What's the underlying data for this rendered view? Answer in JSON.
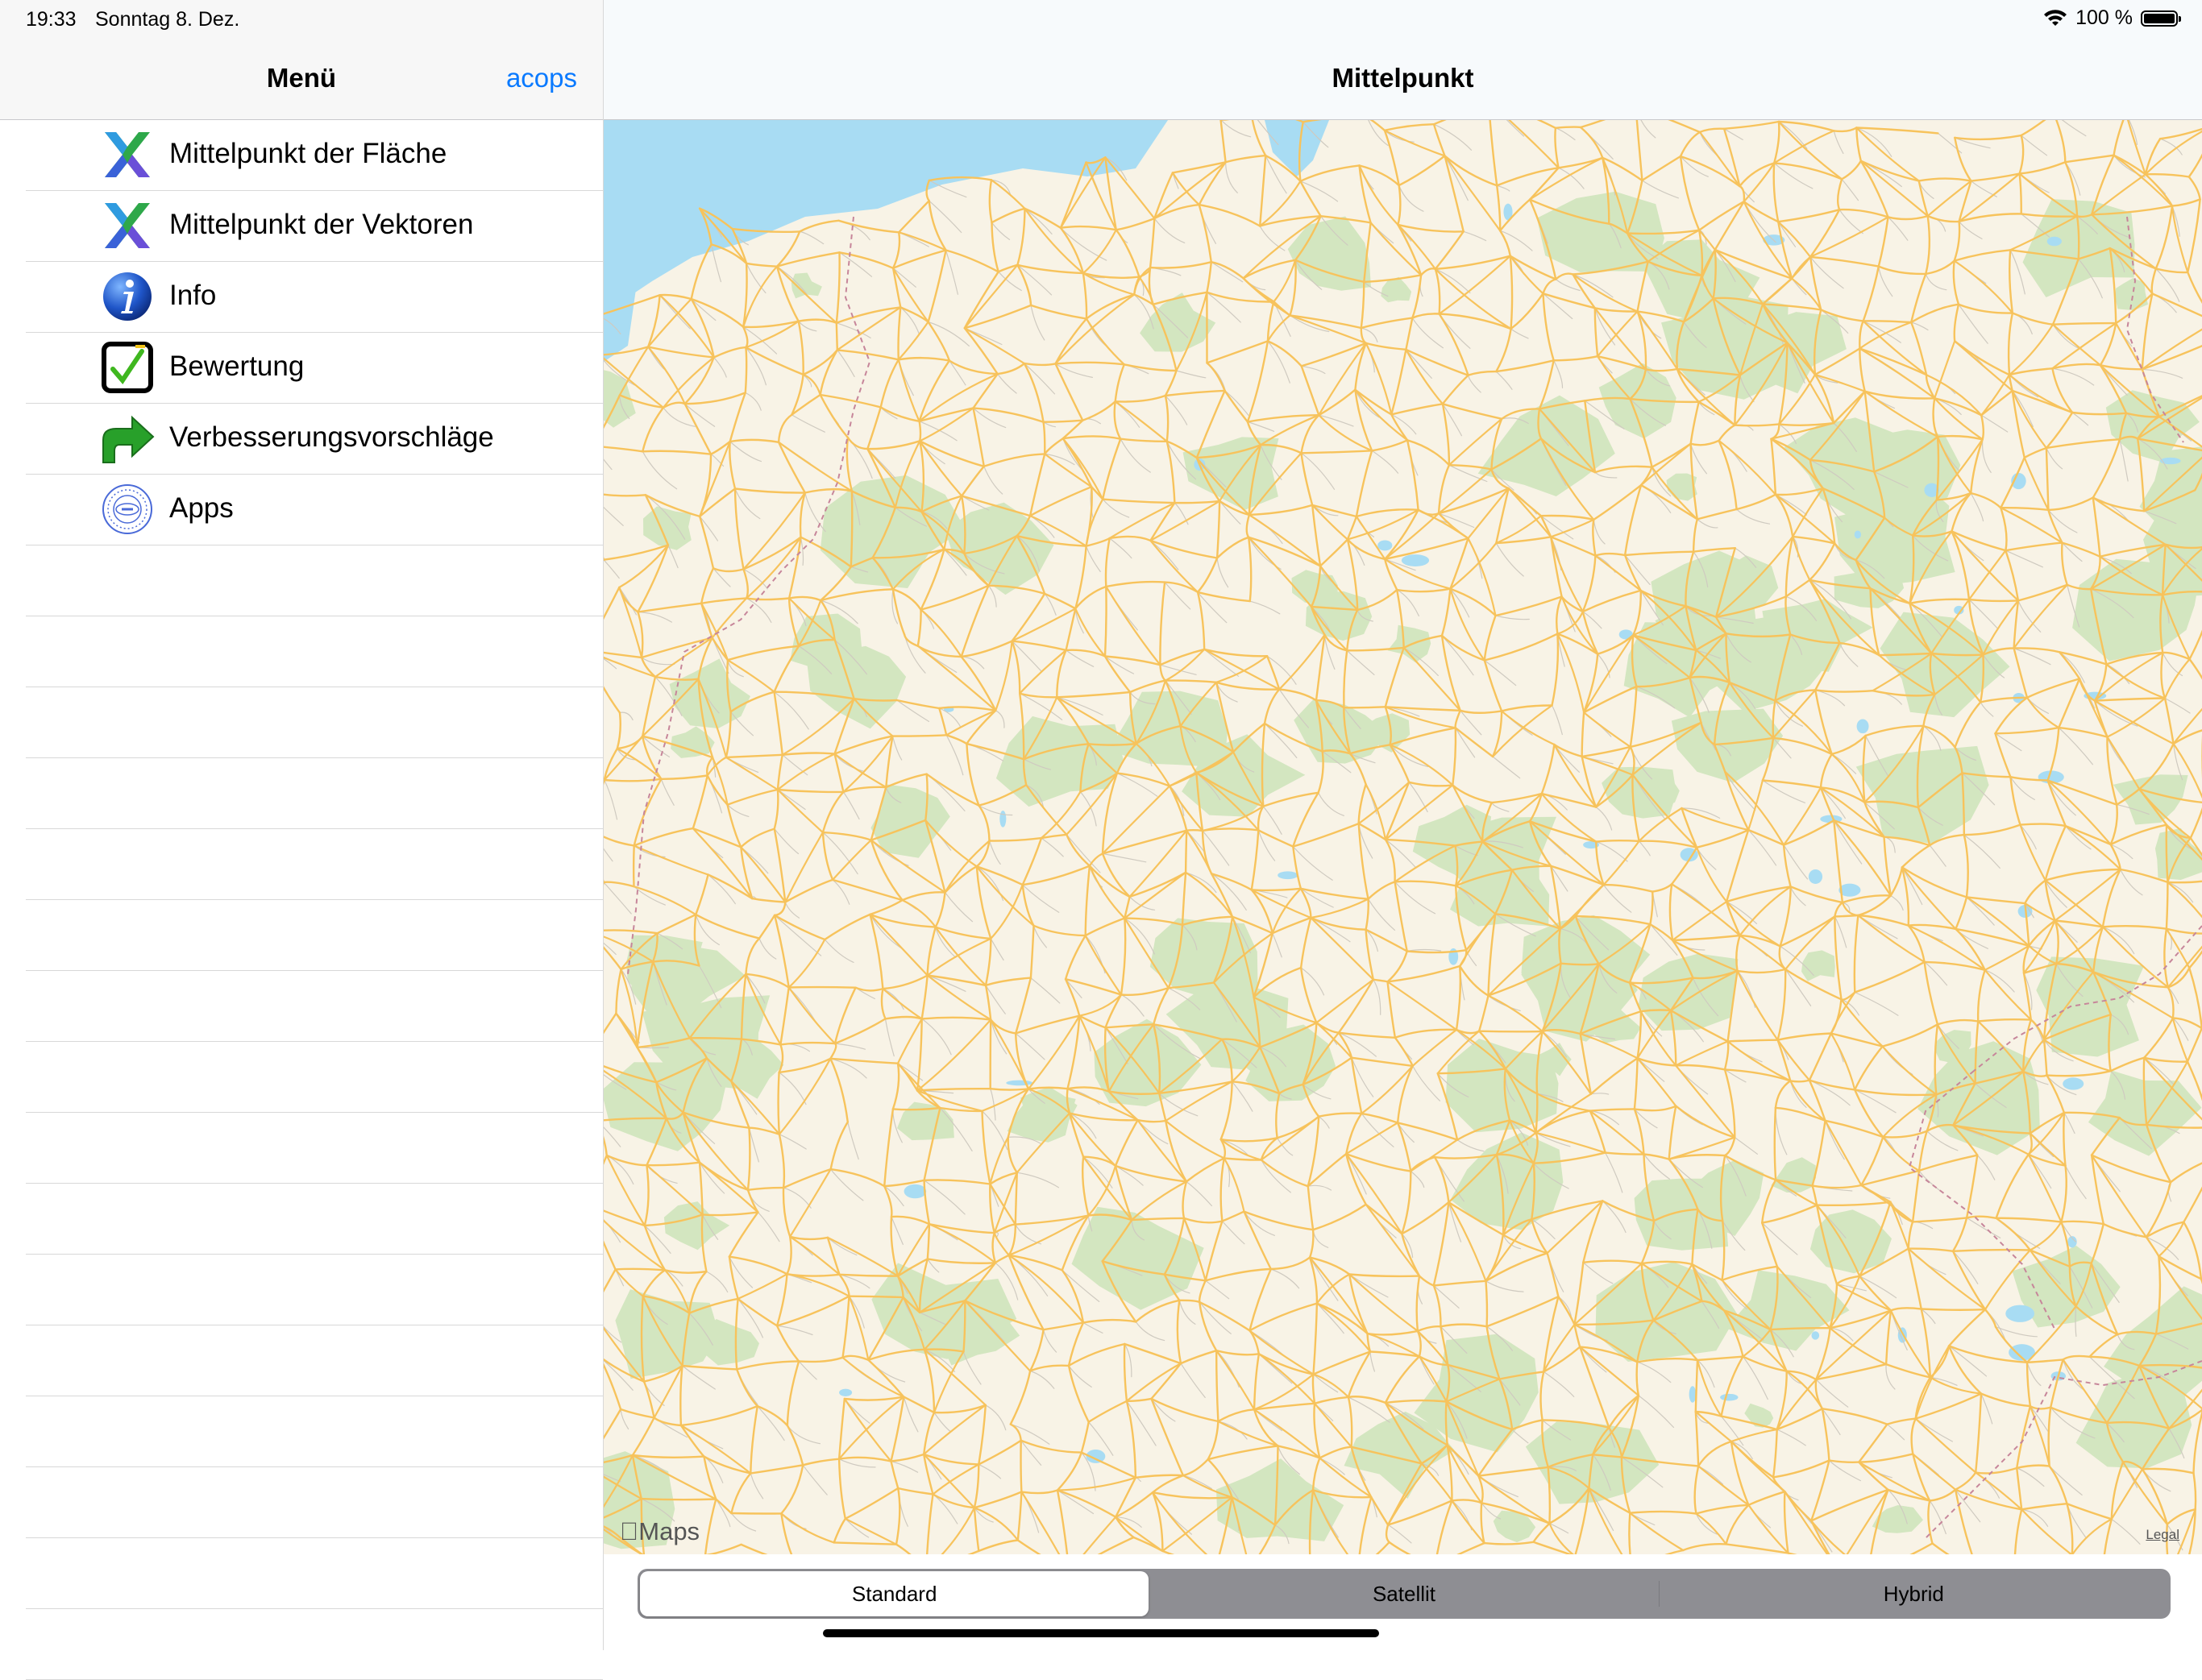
{
  "status": {
    "time": "19:33",
    "date": "Sonntag 8. Dez.",
    "battery": "100 %"
  },
  "sidebar": {
    "title": "Menü",
    "nav_link": "acops",
    "items": [
      {
        "label": "Mittelpunkt der Fläche",
        "icon": "area-center-icon"
      },
      {
        "label": "Mittelpunkt der Vektoren",
        "icon": "vector-center-icon"
      },
      {
        "label": "Info",
        "icon": "info-icon"
      },
      {
        "label": "Bewertung",
        "icon": "checkbox-icon"
      },
      {
        "label": "Verbesserungsvorschläge",
        "icon": "arrow-icon"
      },
      {
        "label": "Apps",
        "icon": "acops-seal-icon"
      }
    ]
  },
  "main": {
    "title": "Mittelpunkt",
    "map": {
      "attribution": "Maps",
      "legal": "Legal"
    },
    "segments": [
      "Standard",
      "Satellit",
      "Hybrid"
    ],
    "selected_segment": "Standard"
  },
  "colors": {
    "accent": "#0a7aff",
    "map_land": "#f8f3e6",
    "map_water": "#a8dcf3",
    "map_forest": "#d3e6c0",
    "map_roads": "#f7c35c"
  }
}
